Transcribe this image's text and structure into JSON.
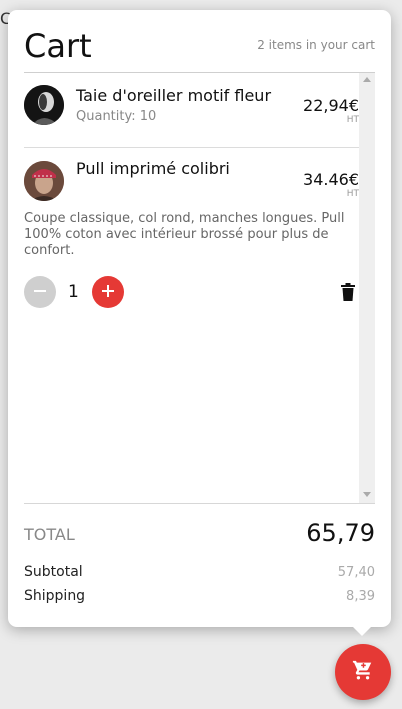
{
  "background": {
    "partial_letter": "C"
  },
  "cart": {
    "title": "Cart",
    "items_count": "2 items in your cart",
    "items": [
      {
        "name": "Taie d'oreiller motif fleur",
        "quantity_text": "Quantity: 10",
        "price": "22,94€",
        "tax_label": "HT",
        "avatar_icon": "person-portrait-dark"
      },
      {
        "name": "Pull imprimé colibri",
        "price": "34.46€",
        "tax_label": "HT",
        "avatar_icon": "person-portrait-bandana",
        "description": "Coupe classique, col rond, manches longues. Pull 100% coton avec intérieur brossé pour plus de confort.",
        "quantity": "1"
      }
    ],
    "total_label": "TOTAL",
    "total_value": "65,79",
    "subtotal_label": "Subtotal",
    "subtotal_value": "57,40",
    "shipping_label": "Shipping",
    "shipping_value": "8,39"
  },
  "icons": {
    "minus": "minus-icon",
    "plus": "plus-icon",
    "trash": "trash-icon",
    "cart_fab": "shopping-cart-icon"
  },
  "colors": {
    "accent": "#e53935",
    "muted_button": "#cfcfcf"
  }
}
